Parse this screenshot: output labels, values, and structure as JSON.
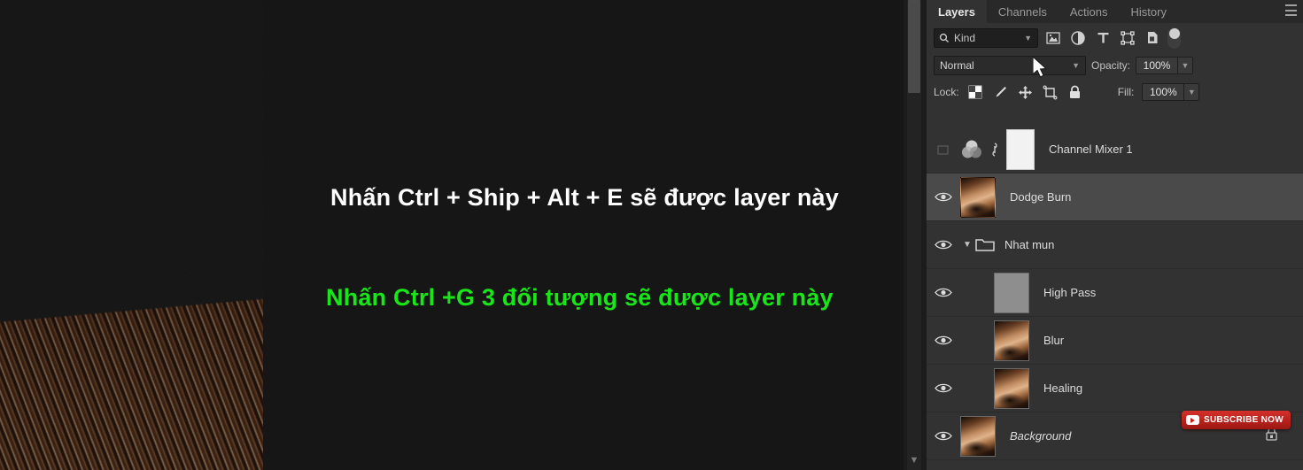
{
  "canvas": {
    "photo_alt": "close-up-skin-and-hair-photo",
    "scrollbar": {
      "position": "right",
      "thumb_top_pct": 0,
      "chevron": "chevron-down-icon"
    }
  },
  "annotations": [
    {
      "text": "Nhấn Ctrl + Ship + Alt + E sẽ được layer này",
      "color": "#ffffff",
      "arrow_color": "#ff0000"
    },
    {
      "text": "Nhấn Ctrl +G 3 đối tượng sẽ được layer này",
      "color": "#19e619",
      "arrow_color": "#ff0000"
    }
  ],
  "panel": {
    "tabs": [
      {
        "label": "Layers",
        "active": true
      },
      {
        "label": "Channels",
        "active": false
      },
      {
        "label": "Actions",
        "active": false
      },
      {
        "label": "History",
        "active": false
      }
    ],
    "menu_icon": "hamburger-menu-icon",
    "filter": {
      "search_icon": "search-icon",
      "kind_value": "Kind",
      "chevron": "chevron-down-icon",
      "icons": [
        "pixel-layer-filter-icon",
        "adjustment-layer-filter-icon",
        "type-layer-filter-icon",
        "shape-layer-filter-icon",
        "smart-object-filter-icon"
      ],
      "toggle": "filter-enable-toggle"
    },
    "blend": {
      "mode_value": "Normal",
      "mode_chevron": "chevron-down-icon",
      "opacity_label": "Opacity:",
      "opacity_value": "100%",
      "opacity_chevron": "chevron-down-icon"
    },
    "lock": {
      "label": "Lock:",
      "icons": [
        "lock-transparent-pixels-icon",
        "lock-image-pixels-icon",
        "lock-position-icon",
        "lock-artboard-nesting-icon",
        "lock-all-icon"
      ],
      "fill_label": "Fill:",
      "fill_value": "100%",
      "fill_chevron": "chevron-down-icon"
    },
    "layers": [
      {
        "name": "Channel Mixer 1",
        "visible": false,
        "type": "adjustment",
        "thumb": "channel-mixer-icon",
        "link_icon": "link-mask-icon",
        "mask": "white-mask",
        "selected": false,
        "indent": 0,
        "italic": false
      },
      {
        "name": "Dodge Burn",
        "visible": true,
        "type": "pixel",
        "thumb": "portrait-thumbnail",
        "selected": true,
        "indent": 0,
        "italic": false
      },
      {
        "name": "Nhat mun",
        "visible": true,
        "type": "group",
        "thumb": "folder-icon",
        "expanded": true,
        "chevron": "chevron-down-icon",
        "selected": false,
        "indent": 0,
        "italic": false
      },
      {
        "name": "High Pass",
        "visible": true,
        "type": "pixel",
        "thumb": "gray-thumbnail",
        "selected": false,
        "indent": 1,
        "italic": false
      },
      {
        "name": "Blur",
        "visible": true,
        "type": "pixel",
        "thumb": "portrait-thumbnail",
        "selected": false,
        "indent": 1,
        "italic": false
      },
      {
        "name": "Healing",
        "visible": true,
        "type": "pixel",
        "thumb": "portrait-thumbnail",
        "selected": false,
        "indent": 1,
        "italic": false
      },
      {
        "name": "Background",
        "visible": true,
        "type": "pixel",
        "thumb": "portrait-thumbnail",
        "selected": false,
        "indent": 0,
        "italic": true,
        "locked": true,
        "lock_icon": "lock-icon"
      }
    ]
  },
  "watermark": {
    "text": "SUBSCRIBE NOW",
    "icon": "youtube-icon",
    "color": "#cc1a14"
  },
  "cursor": {
    "icon": "mouse-pointer-icon"
  }
}
